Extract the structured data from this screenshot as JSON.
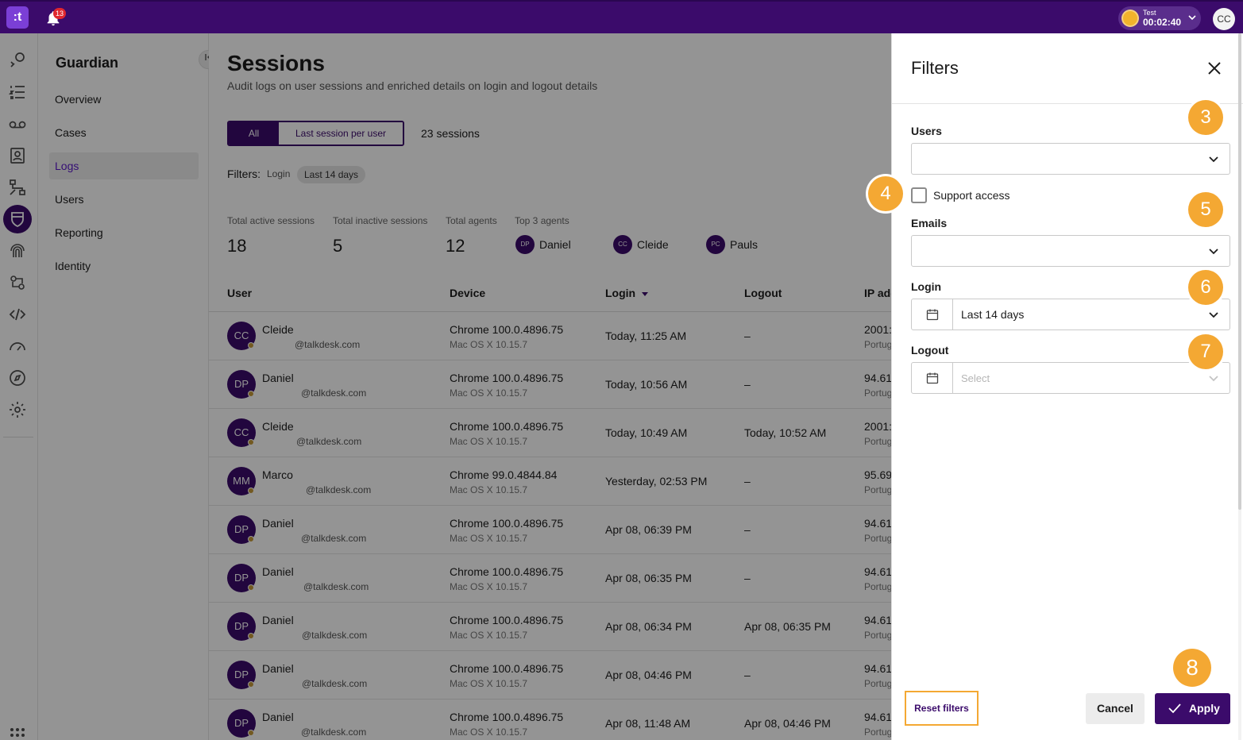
{
  "topbar": {
    "logo": ":t",
    "notifications_count": "13",
    "status_name": "Test",
    "status_timer": "00:02:40",
    "user_initials": "CC",
    "bg_color": "#3b0b6b"
  },
  "rail": {
    "icons": [
      "conversations-icon",
      "list-icon",
      "voicemail-icon",
      "contacts-icon",
      "flow-icon",
      "guardian-shield-icon",
      "fingerprint-icon",
      "automation-icon",
      "code-icon",
      "speed-icon",
      "compass-icon",
      "settings-icon",
      "apps-grid-icon"
    ],
    "active": "guardian-shield-icon"
  },
  "subnav": {
    "title": "Guardian",
    "items": [
      {
        "label": "Overview"
      },
      {
        "label": "Cases"
      },
      {
        "label": "Logs",
        "active": true
      },
      {
        "label": "Users"
      },
      {
        "label": "Reporting"
      },
      {
        "label": "Identity"
      }
    ]
  },
  "main": {
    "title": "Sessions",
    "subtitle": "Audit logs on user sessions and enriched details on login and logout details",
    "segments": [
      "All",
      "Last session per user"
    ],
    "sessions_count": "23 sessions",
    "filters_label": "Filters:",
    "filter_login": "Login",
    "filter_chip": "Last 14 days",
    "stats": [
      {
        "label": "Total active sessions",
        "value": "18"
      },
      {
        "label": "Total inactive sessions",
        "value": "5"
      },
      {
        "label": "Total agents",
        "value": "12"
      }
    ],
    "top_agents_label": "Top 3 agents",
    "top_agents": [
      {
        "initials": "DP",
        "name": "Daniel"
      },
      {
        "initials": "CC",
        "name": "Cleide"
      },
      {
        "initials": "PC",
        "name": "Pauls"
      }
    ],
    "columns": [
      "User",
      "Device",
      "Login",
      "Logout",
      "IP add"
    ],
    "rows": [
      {
        "initials": "CC",
        "name": "Cleide",
        "email": "@talkdesk.com",
        "device": "Chrome 100.0.4896.75",
        "os": "Mac OS X 10.15.7",
        "login": "Today, 11:25 AM",
        "logout": "–",
        "ip": "2001:",
        "loc": "Portug"
      },
      {
        "initials": "DP",
        "name": "Daniel",
        "email": "@talkdesk.com",
        "device": "Chrome 100.0.4896.75",
        "os": "Mac OS X 10.15.7",
        "login": "Today, 10:56 AM",
        "logout": "–",
        "ip": "94.61",
        "loc": "Portug"
      },
      {
        "initials": "CC",
        "name": "Cleide",
        "email": "@talkdesk.com",
        "device": "Chrome 100.0.4896.75",
        "os": "Mac OS X 10.15.7",
        "login": "Today, 10:49 AM",
        "logout": "Today, 10:52 AM",
        "ip": "2001:",
        "loc": "Portug"
      },
      {
        "initials": "MM",
        "name": "Marco",
        "email": "@talkdesk.com",
        "device": "Chrome 99.0.4844.84",
        "os": "Mac OS X 10.15.7",
        "login": "Yesterday, 02:53 PM",
        "logout": "–",
        "ip": "95.69",
        "loc": "Portug"
      },
      {
        "initials": "DP",
        "name": "Daniel",
        "email": "@talkdesk.com",
        "device": "Chrome 100.0.4896.75",
        "os": "Mac OS X 10.15.7",
        "login": "Apr 08, 06:39 PM",
        "logout": "–",
        "ip": "94.61",
        "loc": "Portug"
      },
      {
        "initials": "DP",
        "name": "Daniel",
        "email": "@talkdesk.com",
        "device": "Chrome 100.0.4896.75",
        "os": "Mac OS X 10.15.7",
        "login": "Apr 08, 06:35 PM",
        "logout": "–",
        "ip": "94.61",
        "loc": "Portug"
      },
      {
        "initials": "DP",
        "name": "Daniel",
        "email": "@talkdesk.com",
        "device": "Chrome 100.0.4896.75",
        "os": "Mac OS X 10.15.7",
        "login": "Apr 08, 06:34 PM",
        "logout": "Apr 08, 06:35 PM",
        "ip": "94.61",
        "loc": "Portug"
      },
      {
        "initials": "DP",
        "name": "Daniel",
        "email": "@talkdesk.com",
        "device": "Chrome 100.0.4896.75",
        "os": "Mac OS X 10.15.7",
        "login": "Apr 08, 04:46 PM",
        "logout": "–",
        "ip": "94.61",
        "loc": "Portug"
      },
      {
        "initials": "DP",
        "name": "Daniel",
        "email": "@talkdesk.com",
        "device": "Chrome 100.0.4896.75",
        "os": "Mac OS X 10.15.7",
        "login": "Apr 08, 11:48 AM",
        "logout": "Apr 08, 04:46 PM",
        "ip": "94.61",
        "loc": "Portug"
      }
    ]
  },
  "filters_panel": {
    "title": "Filters",
    "users_label": "Users",
    "users_value": "",
    "support_access_label": "Support access",
    "support_access_checked": false,
    "emails_label": "Emails",
    "emails_value": "",
    "login_label": "Login",
    "login_value": "Last 14 days",
    "logout_label": "Logout",
    "logout_placeholder": "Select",
    "reset_label": "Reset filters",
    "cancel_label": "Cancel",
    "apply_label": "Apply"
  },
  "steps": [
    "3",
    "4",
    "5",
    "6",
    "7",
    "8"
  ],
  "colors": {
    "accent": "#3b0b6b",
    "step_badge": "#f4a833",
    "notification": "#e0272f"
  }
}
